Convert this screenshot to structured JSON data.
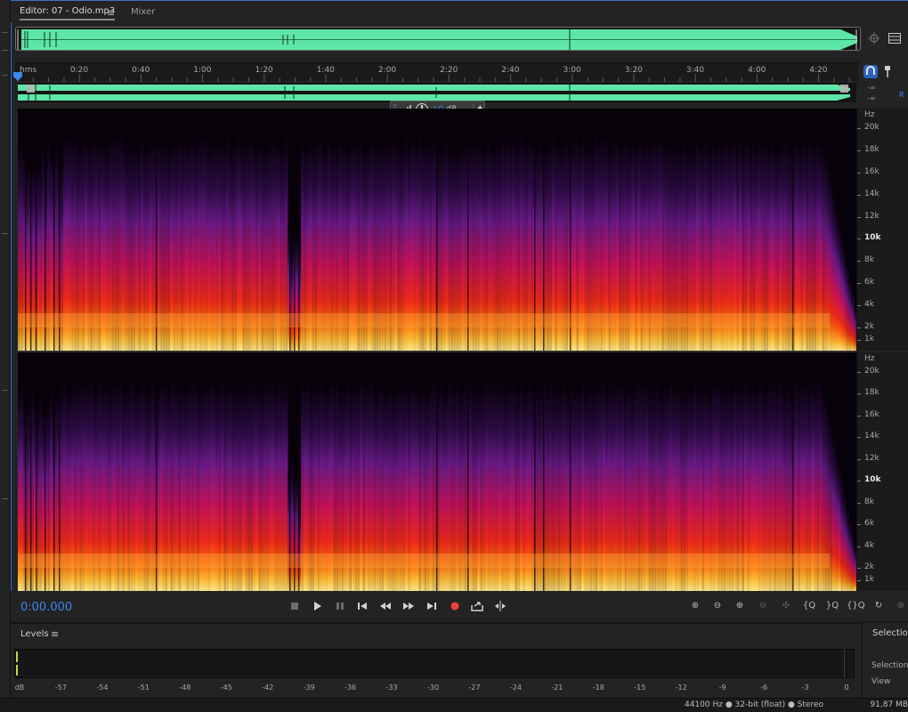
{
  "tabs": {
    "editor_label": "Editor: 07 - Odio.mp3",
    "editor_menu": "≡",
    "mixer_label": "Mixer"
  },
  "ruler": {
    "unit_label": "hms",
    "ticks": [
      "0:20",
      "0:40",
      "1:00",
      "1:20",
      "1:40",
      "2:00",
      "2:20",
      "2:40",
      "3:00",
      "3:20",
      "3:40",
      "4:00",
      "4:20"
    ]
  },
  "lane_readouts": {
    "db_top": "-∞",
    "db_bottom": "-∞",
    "channel_r": "R"
  },
  "hud": {
    "gain_value": "+0",
    "gain_unit": "dB"
  },
  "freq_axis": {
    "unit": "Hz",
    "labels": [
      "20k",
      "18k",
      "16k",
      "14k",
      "12k",
      "10k",
      "8k",
      "6k",
      "4k",
      "2k",
      "1k"
    ],
    "bold_label": "10k"
  },
  "transport": {
    "timecode": "0:00.000"
  },
  "levels": {
    "title": "Levels",
    "menu": "≡",
    "scale": [
      "dB",
      "-57",
      "-54",
      "-51",
      "-48",
      "-45",
      "-42",
      "-39",
      "-36",
      "-33",
      "-30",
      "-27",
      "-24",
      "-21",
      "-18",
      "-15",
      "-12",
      "-9",
      "-6",
      "-3",
      "0"
    ]
  },
  "selection_panel": {
    "title": "Selection/",
    "row1": "Selection",
    "row2": "View"
  },
  "status": {
    "format": "44100 Hz ● 32-bit (float) ● Stereo",
    "size": "91,87 MB"
  },
  "colors": {
    "accent": "#3a88f0",
    "waveform": "#5ee6a8",
    "record": "#e8413a",
    "meter_peak": "#c9d640"
  },
  "icons": {
    "play": "play-icon",
    "stop": "stop-icon",
    "pause": "pause-icon",
    "record": "record-icon",
    "loop": "loop-icon",
    "zoom": "zoom-icon"
  }
}
